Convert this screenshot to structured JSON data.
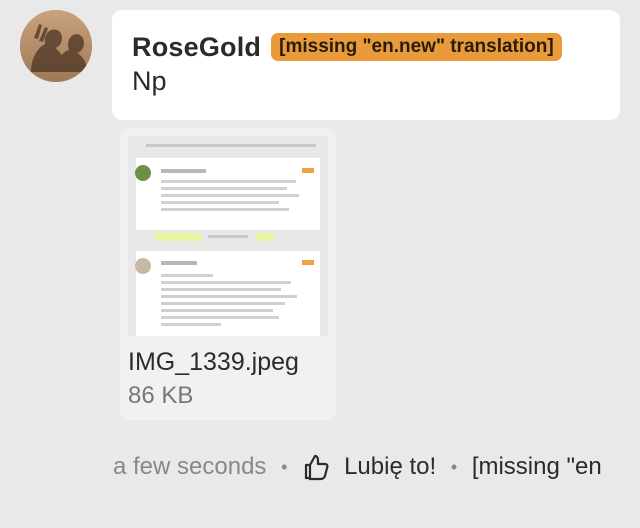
{
  "post": {
    "author": "RoseGold",
    "badge": "[missing \"en.new\" translation]",
    "message": "Np"
  },
  "attachment": {
    "file_name": "IMG_1339.jpeg",
    "file_size": "86 KB",
    "thumbnail_icon": "image-thumbnail"
  },
  "footer": {
    "time": "a few seconds",
    "like_label": "Lubię to!",
    "reply_label": "[missing \"en"
  },
  "colors": {
    "page_bg": "#e9e9ea",
    "badge_bg": "#e99a3a",
    "muted_text": "#888888",
    "main_text": "#2b2b2b"
  }
}
